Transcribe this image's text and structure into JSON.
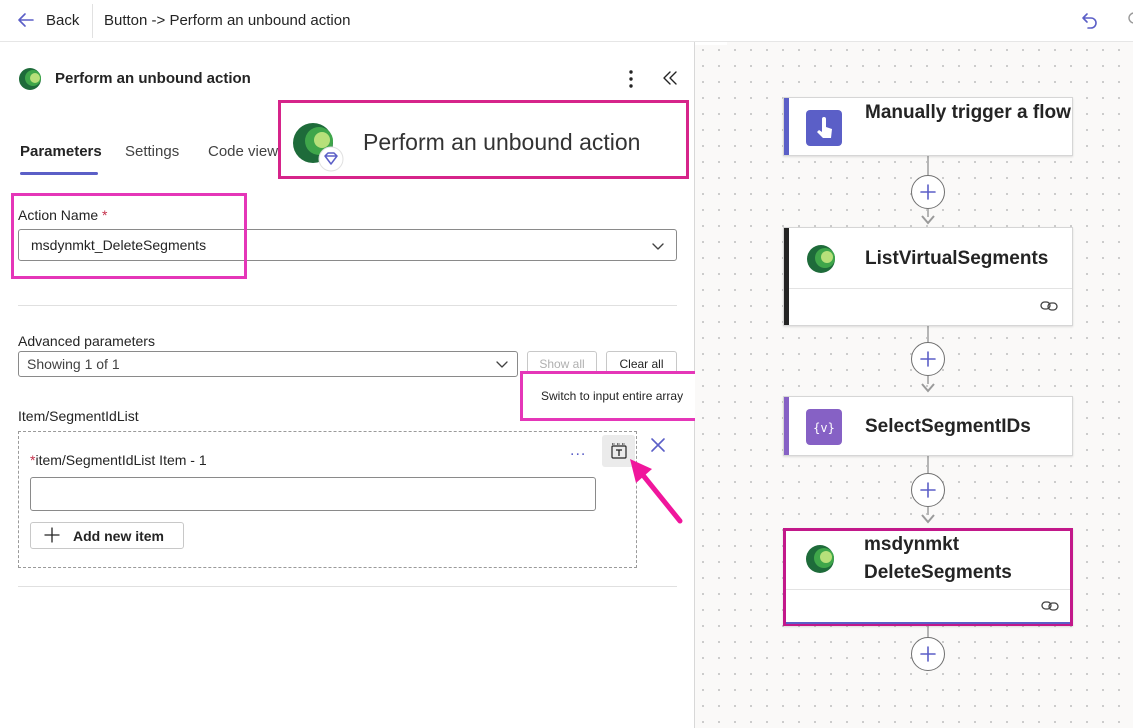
{
  "topbar": {
    "back_label": "Back",
    "breadcrumb": "Button -> Perform an unbound action"
  },
  "panel": {
    "title": "Perform an unbound action",
    "tabs": [
      {
        "label": "Parameters",
        "active": true
      },
      {
        "label": "Settings",
        "active": false
      },
      {
        "label": "Code view",
        "active": false
      }
    ],
    "action_name": {
      "label": "Action Name",
      "required_mark": "*",
      "value": "msdynmkt_DeleteSegments"
    },
    "advanced": {
      "label": "Advanced parameters",
      "value": "Showing 1 of 1",
      "show_all": "Show all",
      "clear_all": "Clear all"
    },
    "array": {
      "label": "Item/SegmentIdList",
      "item_required_mark": "*",
      "item_label": "item/SegmentIdList Item - 1",
      "item_value": "",
      "ellipsis": "...",
      "add_label": "Add new item",
      "tooltip": "Switch to input entire array"
    }
  },
  "callout": {
    "title": "Perform an unbound action"
  },
  "canvas": {
    "nodes": [
      {
        "title": "Manually trigger a flow",
        "icon": "touch-trigger-icon",
        "accent": "#5b5fc7",
        "icon_bg": "#5b5fc7"
      },
      {
        "title": "ListVirtualSegments",
        "icon": "dynamics-icon",
        "accent": "#242424"
      },
      {
        "title": "SelectSegmentIDs",
        "icon": "variable-icon",
        "accent": "#8661c5",
        "icon_bg": "#8661c5"
      },
      {
        "title_line1": "msdynmkt",
        "title_line2": "DeleteSegments",
        "icon": "dynamics-icon"
      }
    ]
  },
  "colors": {
    "accent": "#5b5fc7",
    "annotation": "#e536b8",
    "required": "#c4314b"
  }
}
